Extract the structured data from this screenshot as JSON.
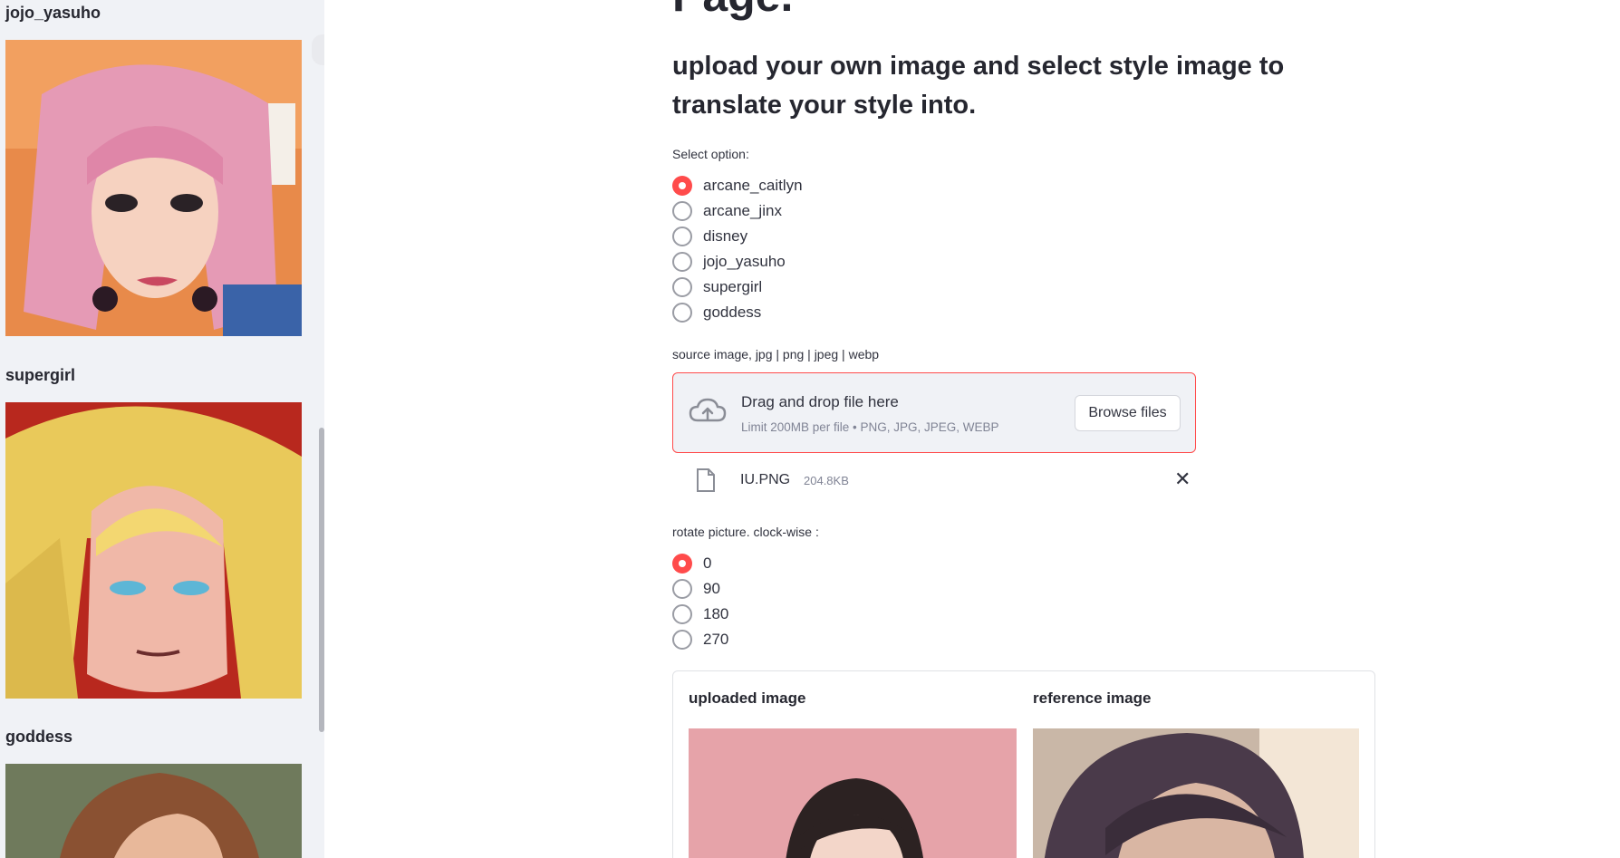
{
  "sidebar": {
    "styles": [
      {
        "label": "jojo_yasuho"
      },
      {
        "label": "supergirl"
      },
      {
        "label": "goddess"
      }
    ]
  },
  "main": {
    "title_partial": "Page.",
    "subtitle": "upload your own image and select style image to translate your style into.",
    "style_option": {
      "label": "Select option:",
      "options": [
        "arcane_caitlyn",
        "arcane_jinx",
        "disney",
        "jojo_yasuho",
        "supergirl",
        "goddess"
      ],
      "selected": "arcane_caitlyn"
    },
    "uploader": {
      "label": "source image, jpg | png | jpeg | webp",
      "drag_text": "Drag and drop file here",
      "limit_text": "Limit 200MB per file • PNG, JPG, JPEG, WEBP",
      "browse_label": "Browse files",
      "file": {
        "name": "IU.PNG",
        "size": "204.8KB"
      }
    },
    "rotate_option": {
      "label": "rotate picture. clock-wise :",
      "options": [
        "0",
        "90",
        "180",
        "270"
      ],
      "selected": "0"
    },
    "images": {
      "uploaded_title": "uploaded image",
      "reference_title": "reference image"
    }
  },
  "colors": {
    "accent": "#ff4b4b",
    "sidebar_bg": "#f0f2f6",
    "text": "#31333f"
  }
}
